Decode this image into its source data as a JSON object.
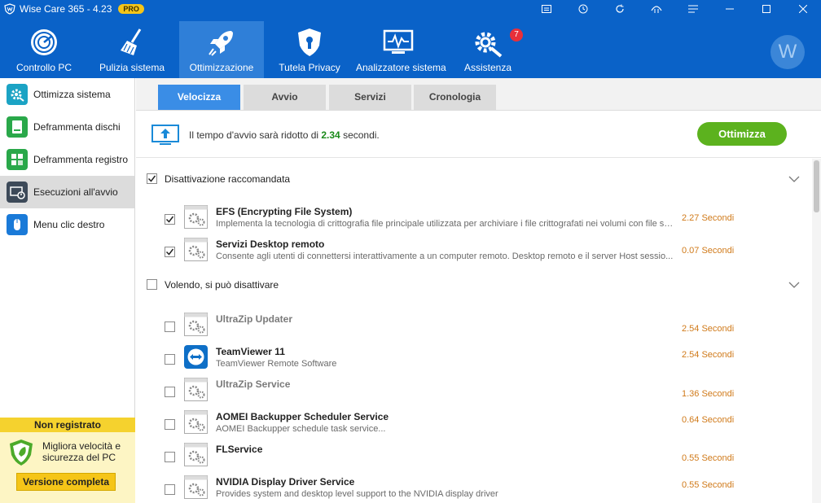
{
  "window": {
    "title": "Wise Care 365 - 4.23",
    "badge": "PRO",
    "controls": [
      "menu-icon",
      "clock-icon",
      "refresh-icon",
      "network-icon",
      "list-icon",
      "minimize-icon",
      "maximize-icon",
      "close-icon"
    ]
  },
  "toolbar": {
    "items": [
      {
        "label": "Controllo PC",
        "icon": "radar-icon"
      },
      {
        "label": "Pulizia sistema",
        "icon": "broom-icon"
      },
      {
        "label": "Ottimizzazione",
        "icon": "rocket-icon",
        "active": true
      },
      {
        "label": "Tutela Privacy",
        "icon": "shield-lock-icon"
      },
      {
        "label": "Analizzatore sistema",
        "icon": "monitor-pulse-icon"
      },
      {
        "label": "Assistenza",
        "icon": "gear-wrench-icon"
      }
    ],
    "assist_badge": "7",
    "avatar_letter": "W"
  },
  "sidebar": {
    "items": [
      {
        "label": "Ottimizza sistema",
        "icon": "optimize-gear-icon"
      },
      {
        "label": "Deframmenta dischi",
        "icon": "disk-icon"
      },
      {
        "label": "Deframmenta registro",
        "icon": "registry-icon"
      },
      {
        "label": "Esecuzioni all'avvio",
        "icon": "startup-icon",
        "active": true
      },
      {
        "label": "Menu clic destro",
        "icon": "mouse-icon"
      }
    ],
    "promo": {
      "header": "Non registrato",
      "text": "Migliora velocità e sicurezza del PC",
      "button": "Versione completa"
    }
  },
  "tabs": [
    {
      "label": "Velocizza",
      "active": true
    },
    {
      "label": "Avvio"
    },
    {
      "label": "Servizi"
    },
    {
      "label": "Cronologia"
    }
  ],
  "banner": {
    "text_before": "Il tempo d'avvio sarà ridotto di ",
    "seconds": "2.34",
    "text_after": " secondi.",
    "button": "Ottimizza"
  },
  "groups": [
    {
      "label": "Disattivazione raccomandata",
      "checked": true,
      "items": [
        {
          "name": "EFS (Encrypting File System)",
          "desc": "Implementa la tecnologia di crittografia file principale utilizzata per archiviare i file crittografati nei volumi con file sy...",
          "time": "2.27 Secondi",
          "checked": true,
          "icon": "service-gear-icon"
        },
        {
          "name": "Servizi Desktop remoto",
          "desc": "Consente agli utenti di connettersi interattivamente a un computer remoto. Desktop remoto e il server Host sessio...",
          "time": "0.07 Secondi",
          "checked": true,
          "icon": "service-gear-icon"
        }
      ]
    },
    {
      "label": "Volendo, si può disattivare",
      "checked": false,
      "items": [
        {
          "name": "UltraZip Updater",
          "desc": "",
          "time": "2.54 Secondi",
          "checked": false,
          "muted": true,
          "icon": "service-gear-icon"
        },
        {
          "name": "TeamViewer 11",
          "desc": "TeamViewer Remote Software",
          "time": "2.54 Secondi",
          "checked": false,
          "icon": "teamviewer-icon"
        },
        {
          "name": "UltraZip Service",
          "desc": "",
          "time": "1.36 Secondi",
          "checked": false,
          "muted": true,
          "icon": "service-gear-icon"
        },
        {
          "name": "AOMEI Backupper Scheduler Service",
          "desc": "AOMEI Backupper schedule task service...",
          "time": "0.64 Secondi",
          "checked": false,
          "icon": "service-gear-icon"
        },
        {
          "name": "FLService",
          "desc": "",
          "time": "0.55 Secondi",
          "checked": false,
          "icon": "service-gear-icon"
        },
        {
          "name": "NVIDIA Display Driver Service",
          "desc": "Provides system and desktop level support to the NVIDIA display driver",
          "time": "0.55 Secondi",
          "checked": false,
          "icon": "service-gear-icon"
        }
      ]
    }
  ]
}
